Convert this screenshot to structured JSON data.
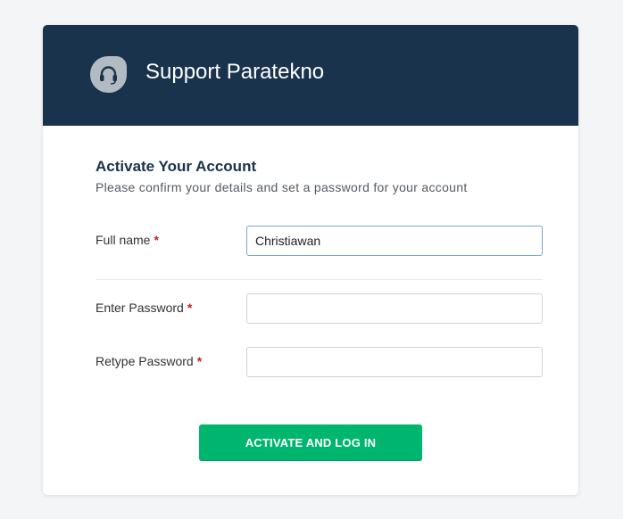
{
  "header": {
    "logo_icon": "headset-icon",
    "brand": "Support Paratekno",
    "bg_color": "#18334b"
  },
  "form": {
    "title": "Activate Your Account",
    "subtitle": "Please confirm your details and set a password for your account",
    "required_mark": "*",
    "full_name": {
      "label": "Full name",
      "value": "Christiawan"
    },
    "password": {
      "label": "Enter Password",
      "value": ""
    },
    "retype_password": {
      "label": "Retype Password",
      "value": ""
    },
    "submit_label": "ACTIVATE AND LOG IN"
  },
  "colors": {
    "accent": "#00b56e",
    "required": "#cc1f1f"
  }
}
